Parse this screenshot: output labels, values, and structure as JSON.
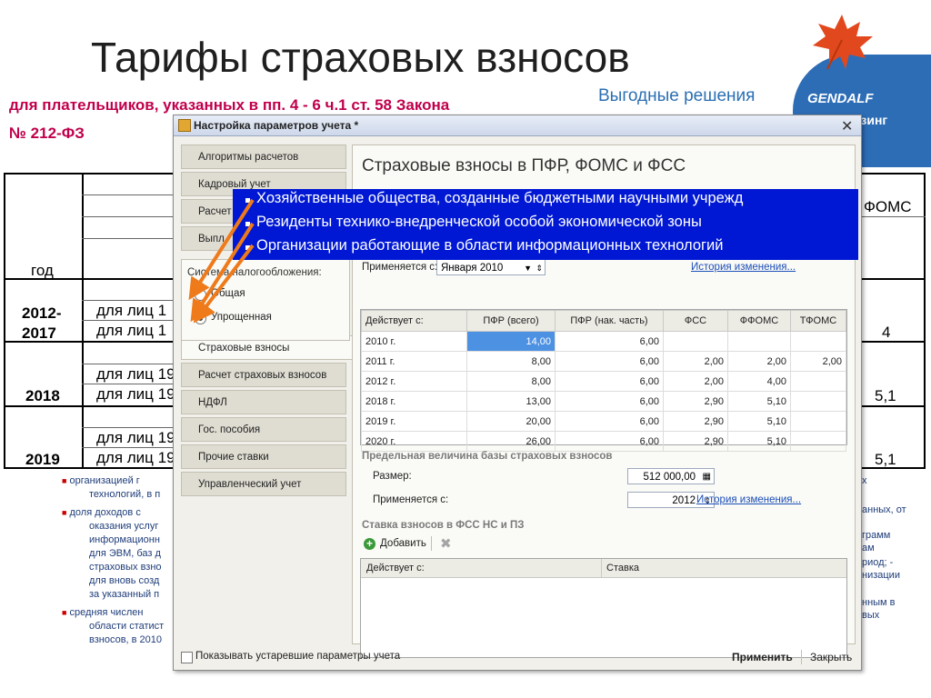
{
  "slide": {
    "title": "Тарифы страховых взносов",
    "subtitle_line1": "для плательщиков, указанных в пп. 4 - 6 ч.1 ст. 58 Закона",
    "subtitle_line2": "№ 212-ФЗ",
    "tagline": "Выгодные решения",
    "logo_text": "GENDALF",
    "logo_sub": "айзинг"
  },
  "background_table": {
    "year_header": "год",
    "foms_header": "ФОМС",
    "rows": [
      {
        "year": "2012-\n2017",
        "label1": "для лиц 1",
        "label2": "для лиц 1",
        "foms": "4"
      },
      {
        "year": "2018",
        "label1": "для лиц 19",
        "label2": "для лиц 19",
        "foms": "5,1"
      },
      {
        "year": "2019",
        "label1": "для лиц 19",
        "label2": "для лиц 19",
        "foms": "5,1"
      }
    ]
  },
  "bullets_left": [
    "организацией г",
    "технологий, в п",
    "доля доходов с",
    "оказания услуг",
    "информационн",
    "для ЭВМ, баз д",
    "страховых взно",
    "для вновь созд",
    "за указанный п",
    "средняя числен",
    "области статист",
    "взносов, в 2010"
  ],
  "bullets_right": [
    "х",
    "анных, от",
    "грамм",
    "ам",
    "риод; -",
    "низации",
    "нным в",
    "вых"
  ],
  "dialog": {
    "title": "Настройка параметров учета *",
    "close": "✕",
    "nav": [
      {
        "label": "Алгоритмы расчетов"
      },
      {
        "label": "Кадровый учет"
      },
      {
        "label": "Расчет"
      },
      {
        "label": "Выпл"
      },
      {
        "label": "Страховые взносы",
        "active": true
      },
      {
        "label": "Расчет страховых взносов"
      },
      {
        "label": "НДФЛ"
      },
      {
        "label": "Гос. пособия"
      },
      {
        "label": "Прочие ставки"
      },
      {
        "label": "Управленческий учет"
      }
    ],
    "tax_system_label": "Система налогообложения:",
    "tax_options": [
      {
        "label": "Общая",
        "selected": false
      },
      {
        "label": "Упрощенная",
        "selected": true
      }
    ],
    "content_title": "Страховые взносы в ПФР, ФОМС и ФСС",
    "applies_from_label": "Применяется с:",
    "applies_from_value": "Января 2010",
    "history_link": "История изменения...",
    "rates_table": {
      "headers": [
        "Действует с:",
        "ПФР (всего)",
        "ПФР (нак. часть)",
        "ФСС",
        "ФФОМС",
        "ТФОМС"
      ],
      "rows": [
        [
          "2010 г.",
          "14,00",
          "6,00",
          "",
          "",
          ""
        ],
        [
          "2011 г.",
          "8,00",
          "6,00",
          "2,00",
          "2,00",
          "2,00"
        ],
        [
          "2012 г.",
          "8,00",
          "6,00",
          "2,00",
          "4,00",
          ""
        ],
        [
          "2018 г.",
          "13,00",
          "6,00",
          "2,90",
          "5,10",
          ""
        ],
        [
          "2019 г.",
          "20,00",
          "6,00",
          "2,90",
          "5,10",
          ""
        ],
        [
          "2020 г.",
          "26,00",
          "6,00",
          "2,90",
          "5,10",
          ""
        ]
      ]
    },
    "limit_section": "Предельная величина базы страховых взносов",
    "size_label": "Размер:",
    "size_value": "512 000,00",
    "applies_label2": "Применяется с:",
    "applies_value2": "2012",
    "history_link2": "История изменения...",
    "fss_section": "Ставка взносов в ФСС НС и ПЗ",
    "add_button": "Добавить",
    "fss_headers": [
      "Действует с:",
      "Ставка"
    ],
    "show_old_label": "Показывать устаревшие параметры учета",
    "apply_button": "Применить",
    "close_button": "Закрыть"
  },
  "highlight": {
    "lines": [
      "Хозяйственные общества, созданные бюджетными научными учрежд",
      "Резиденты технико-внедренческой особой экономической зоны",
      "Организации работающие в области информационных технологий"
    ]
  }
}
